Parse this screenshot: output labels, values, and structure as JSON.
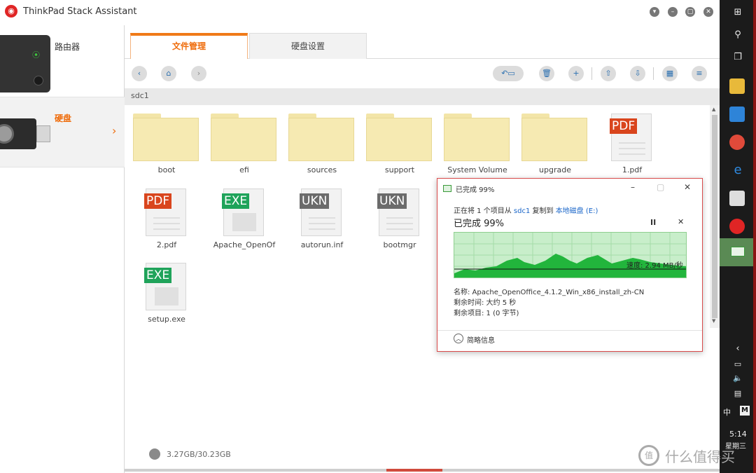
{
  "window": {
    "title": "ThinkPad Stack Assistant",
    "controls": [
      "▾",
      "–",
      "▢",
      "✕"
    ]
  },
  "sidebar": {
    "devices": [
      {
        "label": "路由器"
      },
      {
        "label": "硬盘",
        "arrow": "›"
      }
    ]
  },
  "tabs": [
    {
      "label": "文件管理",
      "active": true
    },
    {
      "label": "硬盘设置",
      "active": false
    }
  ],
  "toolbar": {
    "icons": [
      "back-icon",
      "home-icon",
      "forward-icon",
      "share-icon",
      "delete-icon",
      "new-folder-icon",
      "upload-icon",
      "download-icon",
      "grid-view-icon",
      "sort-icon"
    ]
  },
  "path": "sdc1",
  "files": [
    {
      "name": "boot",
      "type": "folder"
    },
    {
      "name": "efi",
      "type": "folder"
    },
    {
      "name": "sources",
      "type": "folder"
    },
    {
      "name": "support",
      "type": "folder"
    },
    {
      "name": "System Volume",
      "type": "folder"
    },
    {
      "name": "upgrade",
      "type": "folder"
    },
    {
      "name": "1.pdf",
      "type": "doc",
      "badge": "PDF"
    },
    {
      "name": "2.pdf",
      "type": "doc",
      "badge": "PDF"
    },
    {
      "name": "Apache_OpenOf",
      "type": "doc",
      "badge": "EXE"
    },
    {
      "name": "autorun.inf",
      "type": "doc",
      "badge": "UKN"
    },
    {
      "name": "bootmgr",
      "type": "doc",
      "badge": "UKN"
    },
    {
      "name": "setup.exe",
      "type": "doc",
      "badge": "EXE"
    }
  ],
  "footer": {
    "storage": "3.27GB/30.23GB"
  },
  "copy_dialog": {
    "title": "已完成 99%",
    "desc_prefix": "正在将 1 个项目从 ",
    "source": "sdc1",
    "desc_middle": " 复制到 ",
    "destination": "本地磁盘 (E:)",
    "progress_text": "已完成 99%",
    "progress": 0.99,
    "speed": "速度: 2.94 MB/秒",
    "name": "名称: Apache_OpenOffice_4.1.2_Win_x86_install_zh-CN",
    "time_left": "剩余时间: 大约 5 秒",
    "items_left": "剩余项目: 1 (0 字节)",
    "more_info": "简略信息",
    "pause": "II",
    "stop": "✕"
  },
  "taskbar": {
    "clock": "5:14",
    "weekday": "星期三",
    "ime": "中",
    "ime_mode": "M"
  },
  "watermark": "什么值得买",
  "colors": {
    "accent": "#f07a18",
    "pdf_badge": "#d9451d",
    "exe_badge": "#1fa35a",
    "ukn_badge": "#6b6b6b",
    "folder": "#f6eab2",
    "graph_fill": "#1fb33a"
  }
}
